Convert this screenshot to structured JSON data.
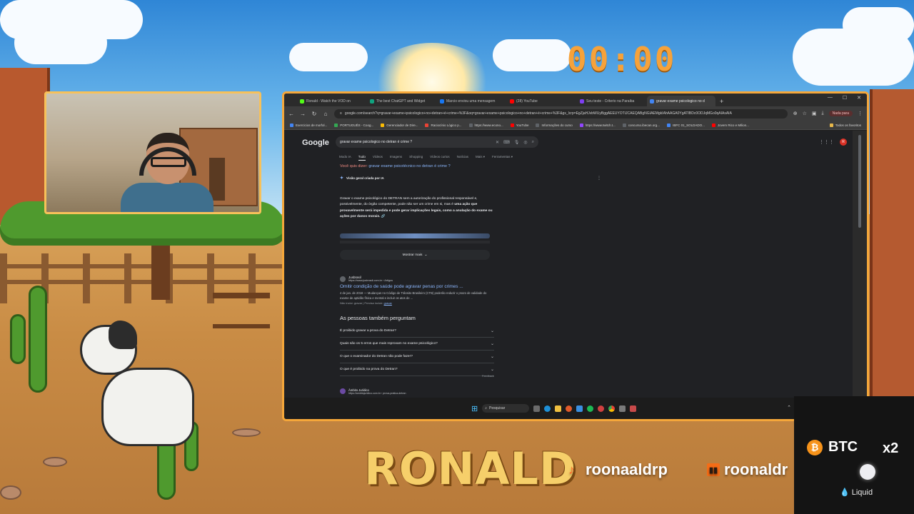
{
  "overlay": {
    "timer": "00:00",
    "streamer_name": "RONALD",
    "tiktok_handle": "roonaaldrp",
    "twitch_handle": "roonaldr",
    "btc": {
      "label": "BTC",
      "multiplier": "x2",
      "liquid_label": "Liquid"
    }
  },
  "browser": {
    "tabs": [
      {
        "label": "Ronald - Watch the VOD on",
        "color": "#53fc18",
        "active": false
      },
      {
        "label": "The best ChatGPT and Widget",
        "color": "#10a37f",
        "active": false
      },
      {
        "label": "Marcio enviou uma mensagem",
        "color": "#1877f2",
        "active": false
      },
      {
        "label": "(28) YouTube",
        "color": "#ff0000",
        "active": false
      },
      {
        "label": "Seu teste - Criterio na Paraiba",
        "color": "#7e3ff2",
        "active": false
      },
      {
        "label": "gravar exame psicologico no d",
        "color": "#4285f4",
        "active": true
      }
    ],
    "new_tab": "+",
    "url": "google.com/search?q=gravar+exame+psicologico+no+detran+é+crime+%3F&oq=gravar+exame+psicologico+no+detran+é+crime+%3F&gs_lcrp=EgZjaHJvbWUyBggAEEUYOTIJCAEQABgNGIAEMgkIAhAAGA0YgATIBDc0ODJqMGo0qAIAsAIA",
    "pause_label": "Nada para",
    "bookmarks": [
      {
        "label": "Exercicios de morfol...",
        "color": "#4285f4"
      },
      {
        "label": "PORTUGUÊS - Coog...",
        "color": "#34a853"
      },
      {
        "label": "Gerenciador de Dire...",
        "color": "#fbbc04"
      },
      {
        "label": "Raciocínio Lógico p...",
        "color": "#ea4335"
      },
      {
        "label": "https://www.econo...",
        "color": "#5f6368"
      },
      {
        "label": "YouTube",
        "color": "#ff0000"
      },
      {
        "label": "Informações do curso",
        "color": "#5f6368"
      },
      {
        "label": "https://www.twitch.t...",
        "color": "#9146ff"
      },
      {
        "label": "concurso.ibecan.org...",
        "color": "#5f6368"
      },
      {
        "label": "IBFC 01_SOLDADO...",
        "color": "#4285f4"
      },
      {
        "label": "Jovem Rico e Milion...",
        "color": "#ff0000"
      }
    ],
    "all_bookmarks": "Todos os favoritos"
  },
  "google": {
    "logo": "Google",
    "query": "gravar exame psicologico no detran é crime ?",
    "avatar_letter": "R",
    "tabs": [
      "Modo IA",
      "Tudo",
      "Vídeos",
      "Imagens",
      "Shopping",
      "Vídeos curtos",
      "Notícias",
      "Mais ▾",
      "Ferramentas ▾"
    ],
    "did_you_mean_prefix": "Você quis dizer:",
    "did_you_mean_query": "gravar exame psicotécnico no detran é crime ?",
    "ai_overview_label": "Visão geral criada por IA",
    "ai_text_plain": "Gravar o exame psicológico do DETRAN sem a autorização do profissional responsável e, possivelmente, do órgão competente, pode não ser um crime em si, mas é ",
    "ai_text_bold": "uma ação que provavelmente será impedida e pode gerar implicações legais, como a anulação do exame ou ações por danos morais.",
    "show_more": "Mostrar mais",
    "result": {
      "site_name": "Jusbrasil",
      "site_url": "https://www.jusbrasil.com.br › Artigos",
      "title": "Omitir condição de saúde pode agravar penas por crimes ...",
      "snippet": "4 de jan. de 2018 — Mudanças no Código de Trânsito Brasileiro (CTB) poderão reduzir o prazo de validade do exame de aptidão física e mental e incluir os atos de ...",
      "missing_prefix": "Não inclui: gravar | Precisa incluir:",
      "missing_link": "gravar"
    },
    "paa_title": "As pessoas também perguntam",
    "paa": [
      "É proibido gravar a prova do Detran?",
      "Quais são os 5 erros que mais reprovam no exame psicológico?",
      "O que o examinador do Detran não pode fazer?",
      "O que é proibido na prova do Detran?"
    ],
    "feedback": "Feedback",
    "result2": {
      "site_name": "Âmbito Jurídico",
      "site_url": "https://ambitojuridico.com.br › prova-pratica-detran"
    }
  },
  "taskbar": {
    "search_label": "Pesquisar"
  }
}
